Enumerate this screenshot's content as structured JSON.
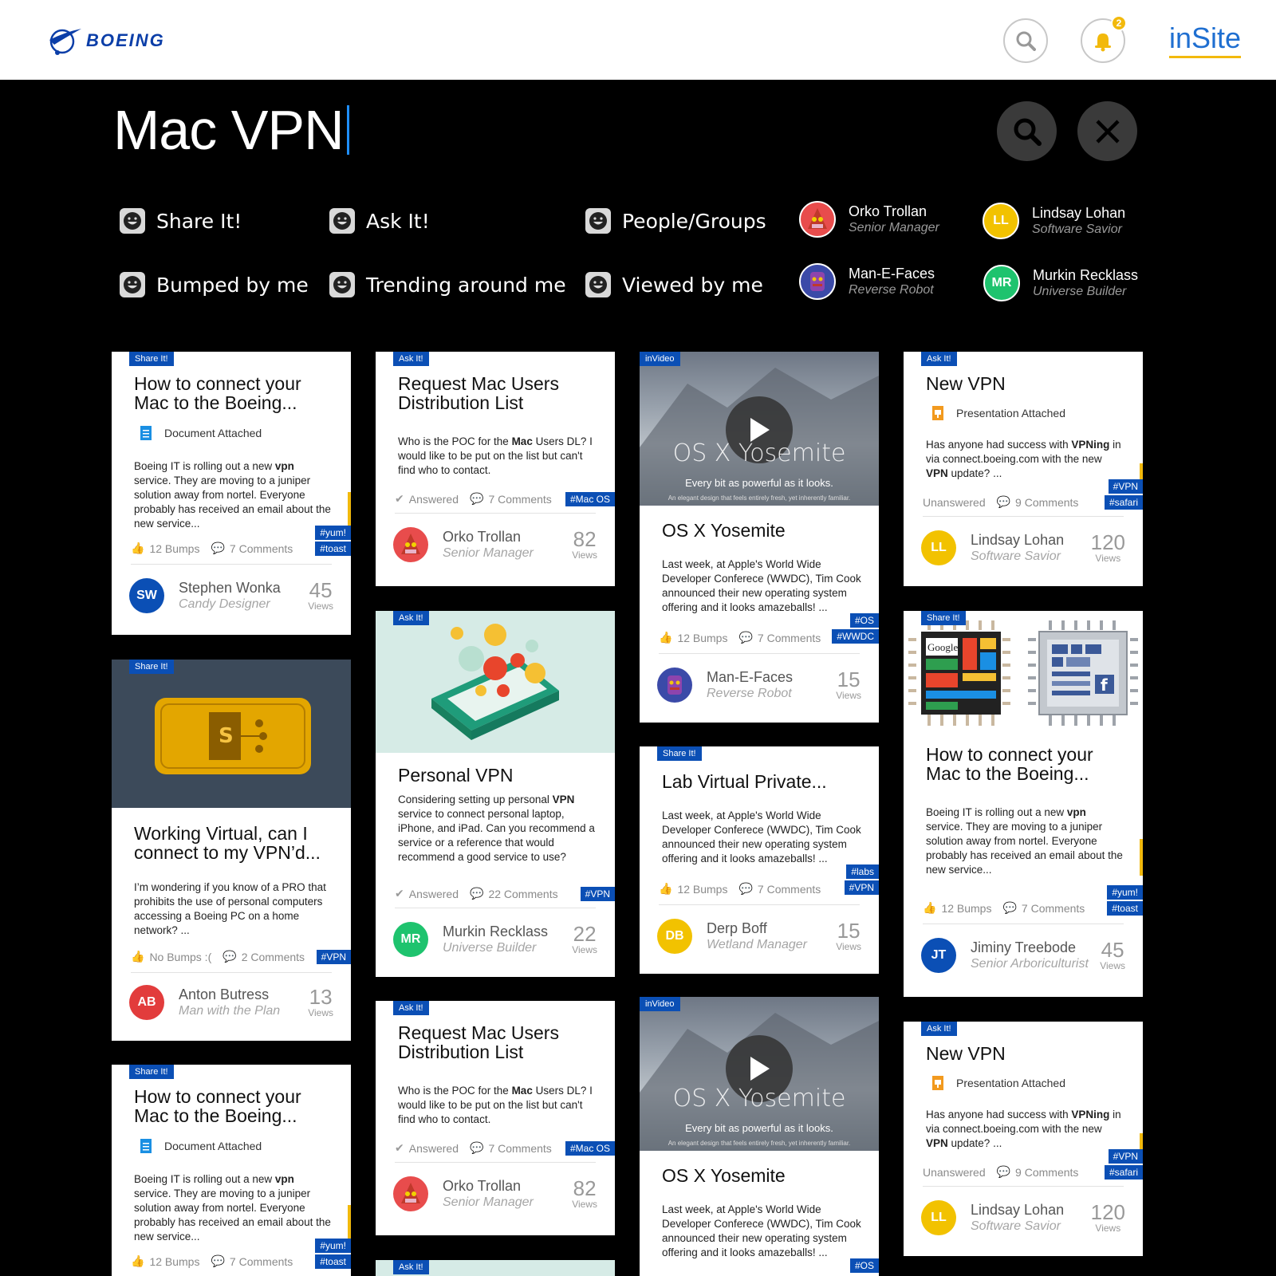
{
  "header": {
    "brand": "BOEING",
    "notif_count": "2",
    "app_name": "inSite"
  },
  "search": {
    "query": "Mac VPN"
  },
  "filters": [
    "Share It!",
    "Ask It!",
    "People/Groups",
    "Bumped by me",
    "Trending around me",
    "Viewed by me"
  ],
  "people": [
    {
      "name": "Orko Trollan",
      "role": "Senior Manager",
      "initials": "",
      "color": "#e84c4c"
    },
    {
      "name": "Lindsay Lohan",
      "role": "Software Savior",
      "initials": "LL",
      "color": "#f2c200"
    },
    {
      "name": "Man-E-Faces",
      "role": "Reverse Robot",
      "initials": "",
      "color": "#3b4aa8"
    },
    {
      "name": "Murkin Recklass",
      "role": "Universe Builder",
      "initials": "MR",
      "color": "#1ec36e"
    }
  ],
  "cards": {
    "c1": {
      "tag": "Share It!",
      "title": "How to connect your Mac to the Boeing...",
      "attach": "Document Attached",
      "body_pre": "Boeing IT is rolling out a new ",
      "body_b": "vpn",
      "body_post": " service. They are moving to a juniper solution away from nortel. Everyone probably has received an email about the new service...",
      "bumps": "12 Bumps",
      "comments": "7 Comments",
      "hash1": "#yum!",
      "hash2": "#toast",
      "author": "Stephen Wonka",
      "role": "Candy Designer",
      "initials": "SW",
      "views": "45",
      "views_label": "Views"
    },
    "c2": {
      "tag": "Share It!",
      "title": "Working Virtual, can I connect to my VPN’d...",
      "body": "I’m wondering if you know of a PRO that prohibits the use of personal computers accessing a Boeing PC on a home network? ...",
      "bumps": "No Bumps :(",
      "comments": "2 Comments",
      "hash1": "#VPN",
      "author": "Anton Butress",
      "role": "Man with the Plan",
      "initials": "AB",
      "views": "13",
      "views_label": "Views"
    },
    "c3": {
      "tag": "Share It!",
      "title": "How to connect your Mac to the Boeing...",
      "attach": "Document Attached",
      "body_pre": "Boeing IT is rolling out a new ",
      "body_b": "vpn",
      "body_post": " service. They are moving to a juniper solution away from nortel. Everyone probably has received an email about the new service...",
      "bumps": "12 Bumps",
      "comments": "7 Comments",
      "hash1": "#yum!",
      "hash2": "#toast"
    },
    "c4": {
      "tag": "Ask It!",
      "title": "Request Mac Users Distribution List",
      "body_pre": "Who is the POC for the ",
      "body_b": "Mac",
      "body_post": " Users DL? I would like to be put on the list but can't find who to contact.",
      "status": "Answered",
      "comments": "7 Comments",
      "hash1": "#Mac OS",
      "author": "Orko Trollan",
      "role": "Senior Manager",
      "views": "82",
      "views_label": "Views"
    },
    "c5": {
      "tag": "Ask It!",
      "title": "Personal VPN",
      "body_pre": "Considering setting up personal ",
      "body_b": "VPN",
      "body_post": " service to connect personal laptop, iPhone, and iPad. Can you recommend a service or a reference that would recommend a good service to use?",
      "status": "Answered",
      "comments": "22 Comments",
      "hash1": "#VPN",
      "author": "Murkin Recklass",
      "role": "Universe Builder",
      "initials": "MR",
      "views": "22",
      "views_label": "Views"
    },
    "c6": {
      "tag": "Ask It!",
      "title": "Request Mac Users Distribution List",
      "body_pre": "Who is the POC for the ",
      "body_b": "Mac",
      "body_post": " Users DL? I would like to be put on the list but can't find who to contact.",
      "status": "Answered",
      "comments": "7 Comments",
      "hash1": "#Mac OS",
      "author": "Orko Trollan",
      "role": "Senior Manager",
      "views": "82",
      "views_label": "Views"
    },
    "c6b": {
      "tag": "Ask It!"
    },
    "c7": {
      "tag": "inVideo",
      "video_title": "OS X Yosemite",
      "video_sub": "Every bit as powerful as it looks.",
      "video_tiny": "An elegant design that feels entirely fresh, yet inherently familiar.",
      "title": "OS X Yosemite",
      "body": "Last week, at Apple's World Wide Developer Conferece (WWDC), Tim Cook announced their new operating system offering and it looks amazeballs! ...",
      "bumps": "12 Bumps",
      "comments": "7 Comments",
      "hash1": "#OS",
      "hash2": "#WWDC",
      "author": "Man-E-Faces",
      "role": "Reverse Robot",
      "views": "15",
      "views_label": "Views"
    },
    "c8": {
      "tag": "Share It!",
      "title": "Lab Virtual Private...",
      "body": "Last week, at Apple's World Wide Developer Conferece (WWDC), Tim Cook announced their new operating system offering and it looks amazeballs! ...",
      "bumps": "12 Bumps",
      "comments": "7 Comments",
      "hash1": "#labs",
      "hash2": "#VPN",
      "author": "Derp Boff",
      "role": "Wetland Manager",
      "initials": "DB",
      "views": "15",
      "views_label": "Views"
    },
    "c9": {
      "tag": "inVideo",
      "video_title": "OS X Yosemite",
      "video_sub": "Every bit as powerful as it looks.",
      "video_tiny": "An elegant design that feels entirely fresh, yet inherently familiar.",
      "title": "OS X Yosemite",
      "body": "Last week, at Apple's World Wide Developer Conferece (WWDC), Tim Cook announced their new operating system offering and it looks amazeballs! ...",
      "hash1": "#OS"
    },
    "c10": {
      "tag": "Ask It!",
      "title": "New VPN",
      "attach": "Presentation Attached",
      "body_pre": "Has anyone had success with ",
      "body_b": "VPNing",
      "body_mid": " in via connect.boeing.com with the new ",
      "body_b2": "VPN",
      "body_post": " update? ...",
      "status": "Unanswered",
      "comments": "9 Comments",
      "hash1": "#VPN",
      "hash2": "#safari",
      "author": "Lindsay Lohan",
      "role": "Software Savior",
      "initials": "LL",
      "views": "120",
      "views_label": "Views"
    },
    "c11": {
      "tag": "Share It!",
      "title": "How to connect your Mac to the Boeing...",
      "img_label": "Google",
      "body_pre": "Boeing IT is rolling out a new ",
      "body_b": "vpn",
      "body_post": " service. They are moving to a juniper solution away from nortel. Everyone probably has received an email about the new service...",
      "bumps": "12 Bumps",
      "comments": "7 Comments",
      "hash1": "#yum!",
      "hash2": "#toast",
      "author": "Jiminy Treebode",
      "role": "Senior Arboriculturist",
      "initials": "JT",
      "views": "45",
      "views_label": "Views"
    },
    "c12": {
      "tag": "Ask It!",
      "title": "New VPN",
      "attach": "Presentation Attached",
      "body_pre": "Has anyone had success with ",
      "body_b": "VPNing",
      "body_mid": " in via connect.boeing.com with the new ",
      "body_b2": "VPN",
      "body_post": " update? ...",
      "status": "Unanswered",
      "comments": "9 Comments",
      "hash1": "#VPN",
      "hash2": "#safari",
      "author": "Lindsay Lohan",
      "role": "Software Savior",
      "initials": "LL",
      "views": "120",
      "views_label": "Views"
    }
  },
  "colors": {
    "accent": "#0b4fb5",
    "brand_yellow": "#f2b90c",
    "link_blue": "#1f6fd1"
  }
}
